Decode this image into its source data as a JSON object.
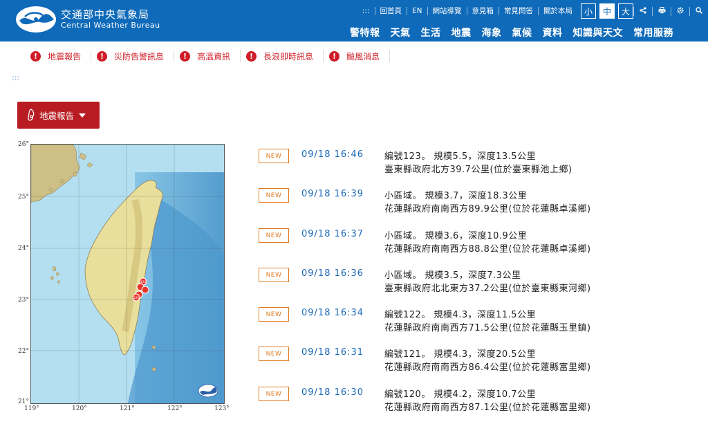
{
  "header": {
    "brand_zh": "交通部中央氣象局",
    "brand_en": "Central Weather Bureau",
    "utility": [
      ":::",
      "回首頁",
      "EN",
      "網站導覽",
      "意見箱",
      "常見問答",
      "關於本局"
    ],
    "font_sizes": [
      "小",
      "中",
      "大"
    ],
    "active_font_size": "中",
    "utility_icons": [
      "share-icon",
      "print-icon",
      "gear-icon",
      "search-icon"
    ],
    "nav": [
      "警特報",
      "天氣",
      "生活",
      "地震",
      "海象",
      "氣候",
      "資料",
      "知識與天文",
      "常用服務"
    ],
    "color": "#0f6ab9"
  },
  "alerts": [
    "地震報告",
    "災防告警訊息",
    "高溫資訊",
    "長浪即時訊息",
    "颱風消息"
  ],
  "accesskey": ":::",
  "section": {
    "label": "地震報告",
    "color": "#b81c22"
  },
  "map": {
    "lat_ticks": [
      "26°",
      "25°",
      "24°",
      "23°",
      "22°",
      "21°"
    ],
    "lon_ticks": [
      "119°",
      "120°",
      "121°",
      "122°",
      "123°"
    ],
    "markers": [
      "123",
      "120"
    ]
  },
  "badge_label": "NEW",
  "reports": [
    {
      "time": "09/18 16:46",
      "line1": "編號123。 規模5.5，深度13.5公里",
      "line2": "臺東縣政府北方39.7公里(位於臺東縣池上鄉)"
    },
    {
      "time": "09/18 16:39",
      "line1": "小區域。 規模3.7，深度18.3公里",
      "line2": "花蓮縣政府南南西方89.9公里(位於花蓮縣卓溪鄉)"
    },
    {
      "time": "09/18 16:37",
      "line1": "小區域。 規模3.6，深度10.9公里",
      "line2": "花蓮縣政府南南西方88.8公里(位於花蓮縣卓溪鄉)"
    },
    {
      "time": "09/18 16:36",
      "line1": "小區域。 規模3.5，深度7.3公里",
      "line2": "臺東縣政府北北東方37.2公里(位於臺東縣東河鄉)"
    },
    {
      "time": "09/18 16:34",
      "line1": "編號122。 規模4.3，深度11.5公里",
      "line2": "花蓮縣政府南南西方71.5公里(位於花蓮縣玉里鎮)"
    },
    {
      "time": "09/18 16:31",
      "line1": "編號121。 規模4.3，深度20.5公里",
      "line2": "花蓮縣政府南南西方86.4公里(位於花蓮縣富里鄉)"
    },
    {
      "time": "09/18 16:30",
      "line1": "編號120。 規模4.2，深度10.7公里",
      "line2": "花蓮縣政府南南西方87.1公里(位於花蓮縣富里鄉)"
    }
  ]
}
